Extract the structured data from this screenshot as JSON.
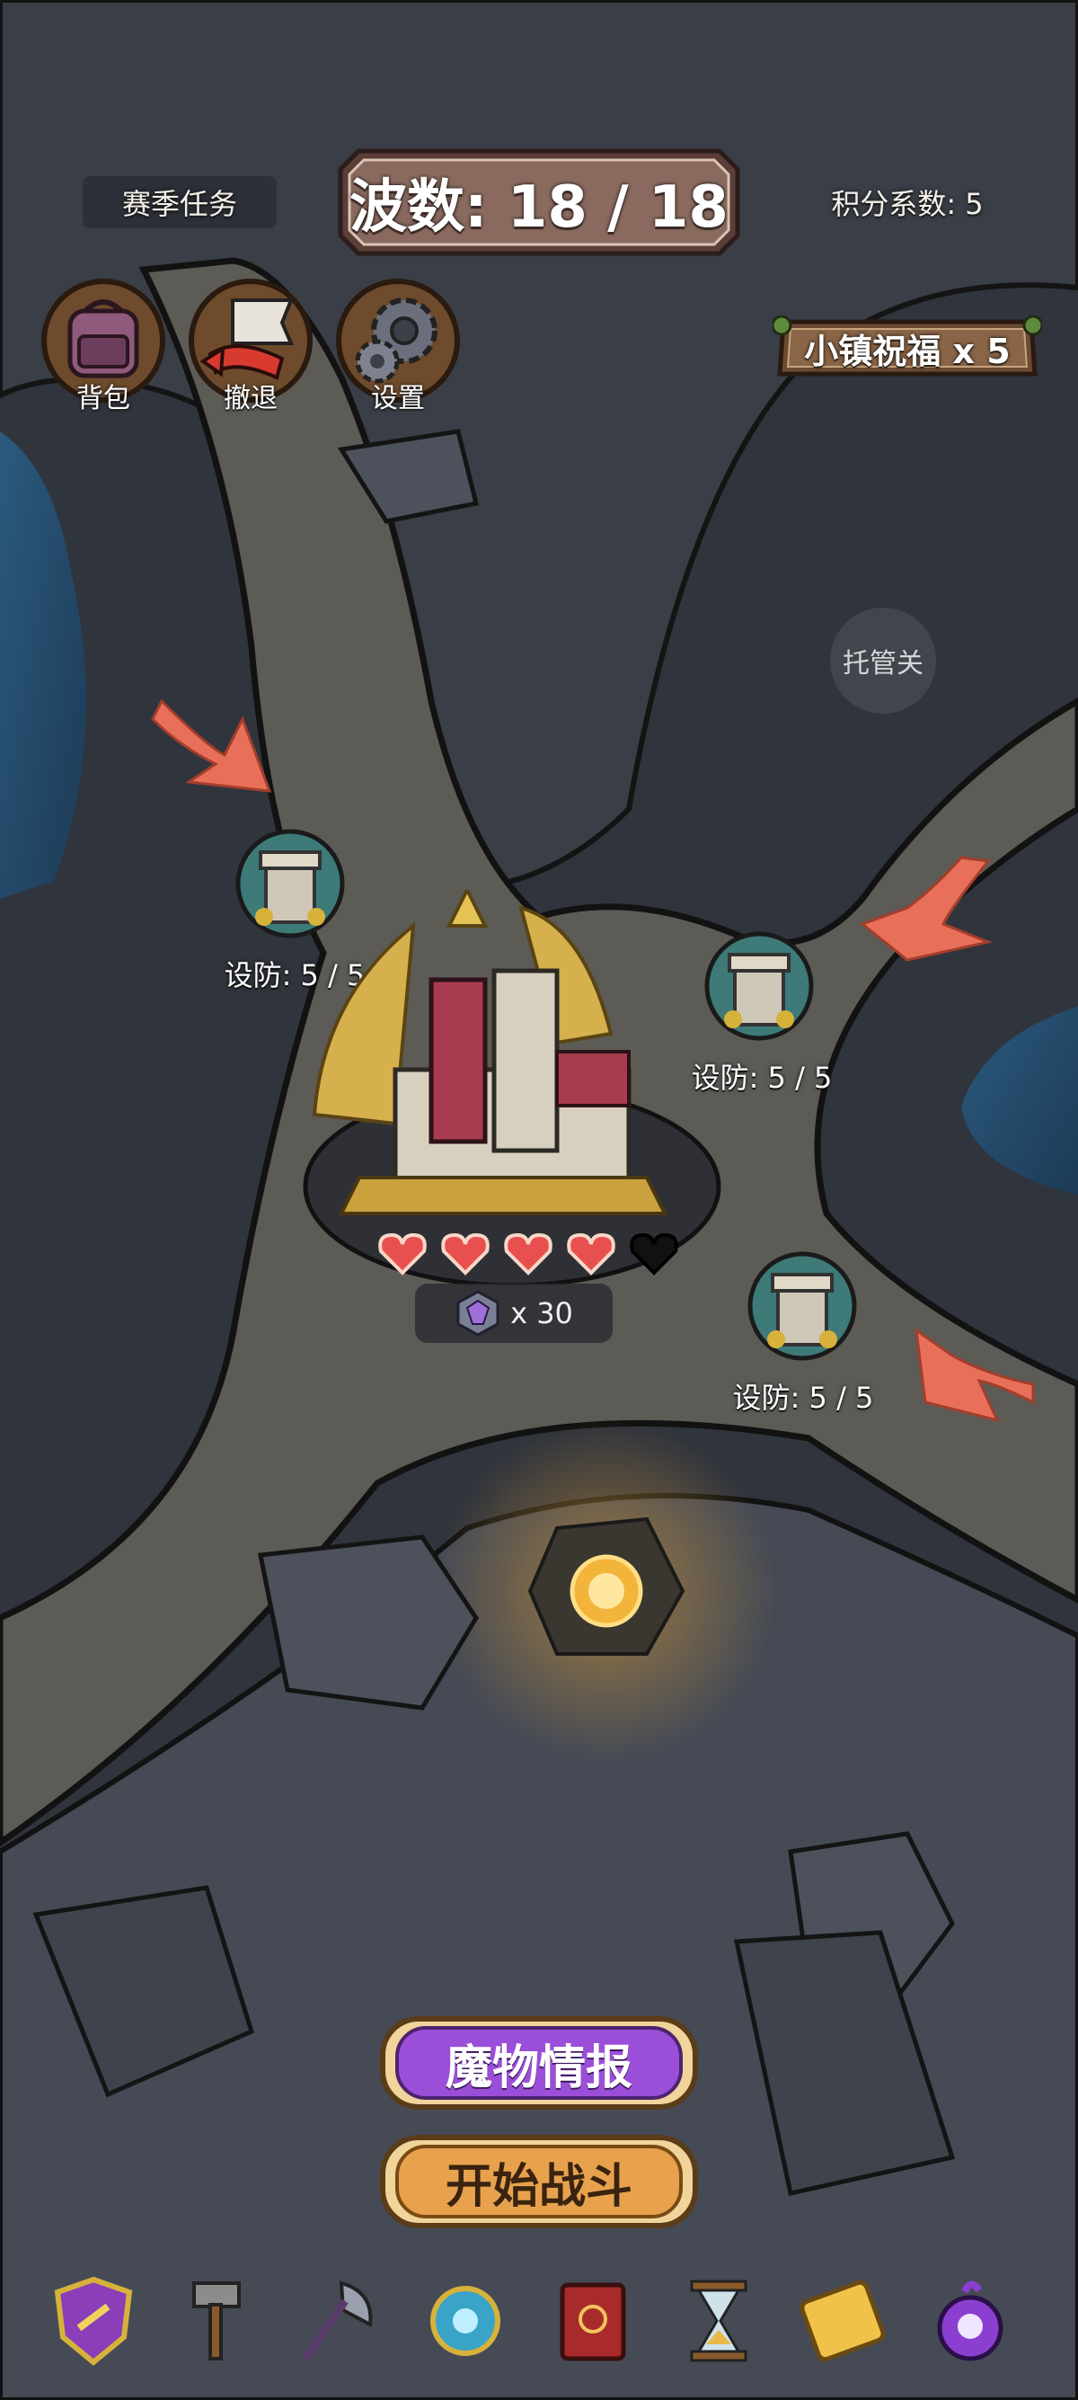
{
  "header": {
    "season_task": "赛季任务",
    "wave_label": "波数: 18 / 18",
    "score_factor": "积分系数: 5"
  },
  "toolbar": {
    "bag": "背包",
    "retreat": "撤退",
    "settings": "设置"
  },
  "blessing": "小镇祝福 x 5",
  "auto_btn": "托管关",
  "towers": [
    {
      "label": "设防: 5 / 5"
    },
    {
      "label": "设防: 5 / 5"
    },
    {
      "label": "设防: 5 / 5"
    }
  ],
  "castle": {
    "hearts_full": 4,
    "hearts_total": 5,
    "gem_count": "x 30"
  },
  "actions": {
    "monster_info": "魔物情报",
    "start_battle": "开始战斗"
  },
  "bottom_nav": [
    "shield-icon",
    "hammer-icon",
    "axe-icon",
    "orb-icon",
    "book-icon",
    "hourglass-icon",
    "ticket-icon",
    "skull-potion-icon"
  ],
  "colors": {
    "ground": "#3b3f47",
    "path": "#5b5a55",
    "arrow": "#e8705a",
    "monster_btn": "#9b4fd8",
    "start_btn": "#e8a24e"
  }
}
